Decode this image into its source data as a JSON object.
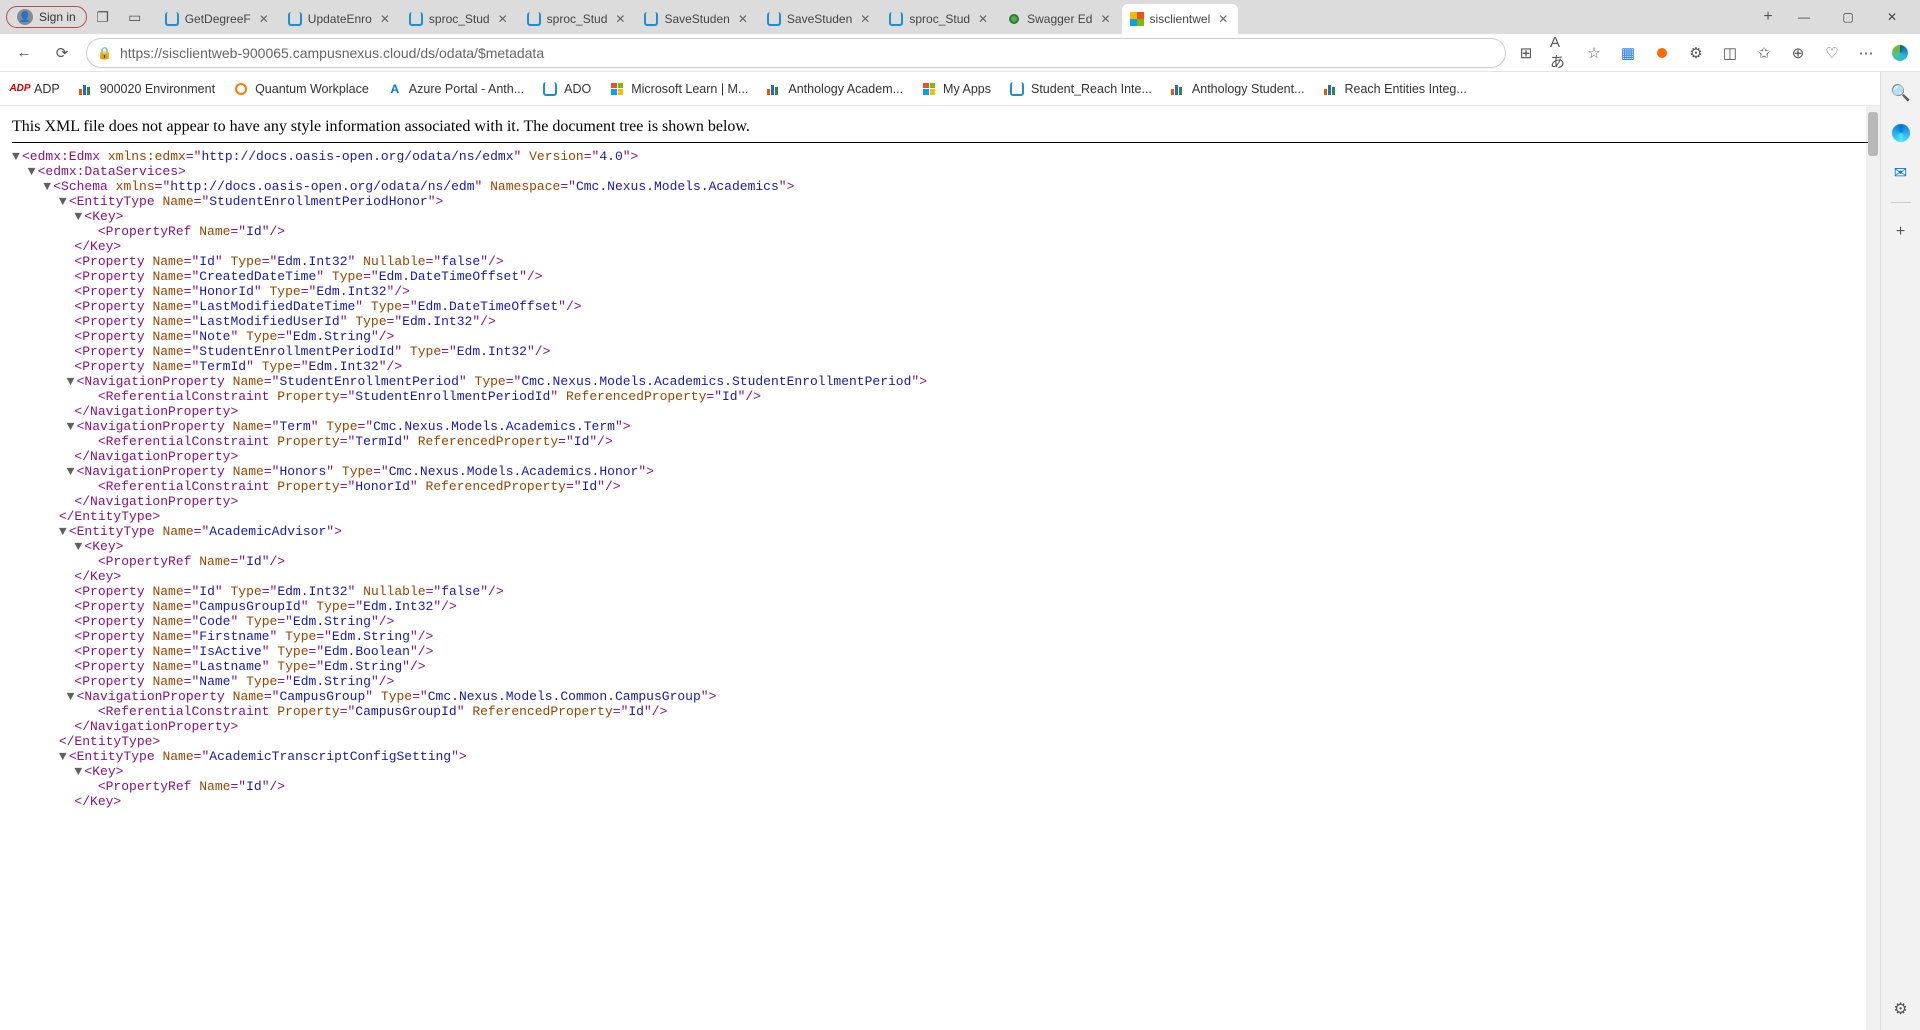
{
  "titlebar": {
    "signin": "Sign in"
  },
  "tabs": [
    {
      "title": "GetDegreeF",
      "icon": "blue",
      "active": false
    },
    {
      "title": "UpdateEnro",
      "icon": "blue",
      "active": false
    },
    {
      "title": "sproc_Stud",
      "icon": "blue",
      "active": false
    },
    {
      "title": "sproc_Stud",
      "icon": "blue",
      "active": false
    },
    {
      "title": "SaveStuden",
      "icon": "blue",
      "active": false
    },
    {
      "title": "SaveStuden",
      "icon": "blue",
      "active": false
    },
    {
      "title": "sproc_Stud",
      "icon": "blue",
      "active": false
    },
    {
      "title": "Swagger Ed",
      "icon": "green",
      "active": false
    },
    {
      "title": "sisclientwel",
      "icon": "multi",
      "active": true
    }
  ],
  "url": "https://sisclientweb-900065.campusnexus.cloud/ds/odata/$metadata",
  "bookmarks": [
    {
      "label": "ADP",
      "icon": "adp"
    },
    {
      "label": "900020 Environment",
      "icon": "bars"
    },
    {
      "label": "Quantum Workplace",
      "icon": "qw"
    },
    {
      "label": "Azure Portal - Anth...",
      "icon": "azure"
    },
    {
      "label": "ADO",
      "icon": "blue"
    },
    {
      "label": "Microsoft Learn | M...",
      "icon": "ms4"
    },
    {
      "label": "Anthology Academ...",
      "icon": "bars"
    },
    {
      "label": "My Apps",
      "icon": "ms4"
    },
    {
      "label": "Student_Reach Inte...",
      "icon": "blue"
    },
    {
      "label": "Anthology Student...",
      "icon": "bars"
    },
    {
      "label": "Reach Entities Integ...",
      "icon": "bars"
    }
  ],
  "banner": "This XML file does not appear to have any style information associated with it. The document tree is shown below.",
  "xml": {
    "edmx_ns": "http://docs.oasis-open.org/odata/ns/edmx",
    "edmx_version": "4.0",
    "schema_ns": "http://docs.oasis-open.org/odata/ns/edm",
    "schema_namespace": "Cmc.Nexus.Models.Academics",
    "entities": [
      {
        "name": "StudentEnrollmentPeriodHonor",
        "key": "Id",
        "properties": [
          {
            "name": "Id",
            "type": "Edm.Int32",
            "nullable": "false"
          },
          {
            "name": "CreatedDateTime",
            "type": "Edm.DateTimeOffset"
          },
          {
            "name": "HonorId",
            "type": "Edm.Int32"
          },
          {
            "name": "LastModifiedDateTime",
            "type": "Edm.DateTimeOffset"
          },
          {
            "name": "LastModifiedUserId",
            "type": "Edm.Int32"
          },
          {
            "name": "Note",
            "type": "Edm.String"
          },
          {
            "name": "StudentEnrollmentPeriodId",
            "type": "Edm.Int32"
          },
          {
            "name": "TermId",
            "type": "Edm.Int32"
          }
        ],
        "navs": [
          {
            "name": "StudentEnrollmentPeriod",
            "type": "Cmc.Nexus.Models.Academics.StudentEnrollmentPeriod",
            "refprop": "StudentEnrollmentPeriodId",
            "refd": "Id"
          },
          {
            "name": "Term",
            "type": "Cmc.Nexus.Models.Academics.Term",
            "refprop": "TermId",
            "refd": "Id"
          },
          {
            "name": "Honors",
            "type": "Cmc.Nexus.Models.Academics.Honor",
            "refprop": "HonorId",
            "refd": "Id"
          }
        ]
      },
      {
        "name": "AcademicAdvisor",
        "key": "Id",
        "properties": [
          {
            "name": "Id",
            "type": "Edm.Int32",
            "nullable": "false"
          },
          {
            "name": "CampusGroupId",
            "type": "Edm.Int32"
          },
          {
            "name": "Code",
            "type": "Edm.String"
          },
          {
            "name": "Firstname",
            "type": "Edm.String"
          },
          {
            "name": "IsActive",
            "type": "Edm.Boolean"
          },
          {
            "name": "Lastname",
            "type": "Edm.String"
          },
          {
            "name": "Name",
            "type": "Edm.String"
          }
        ],
        "navs": [
          {
            "name": "CampusGroup",
            "type": "Cmc.Nexus.Models.Common.CampusGroup",
            "refprop": "CampusGroupId",
            "refd": "Id"
          }
        ]
      },
      {
        "name": "AcademicTranscriptConfigSetting",
        "key": "Id",
        "properties": [],
        "navs": [],
        "partial": true
      }
    ]
  }
}
